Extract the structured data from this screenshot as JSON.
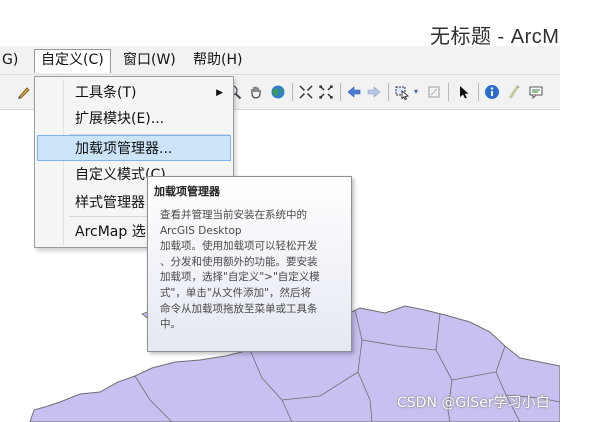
{
  "window": {
    "title": "无标题 - ArcM"
  },
  "menubar": {
    "items": [
      {
        "label": "G)"
      },
      {
        "label": "自定义(C)"
      },
      {
        "label": "窗口(W)"
      },
      {
        "label": "帮助(H)"
      }
    ]
  },
  "toolbar": {
    "icons": [
      "edit-icon",
      "zoom-in-icon",
      "pan-hand-icon",
      "full-extent-globe-icon",
      "fixed-zoom-in-icon",
      "fixed-zoom-out-icon",
      "back-arrow-icon",
      "forward-arrow-icon",
      "select-features-icon",
      "clear-selection-icon",
      "select-elements-icon",
      "identify-icon",
      "hyperlink-icon",
      "html-popup-icon"
    ]
  },
  "dropdown": {
    "items": [
      {
        "label": "工具条(T)",
        "has_submenu": true
      },
      {
        "label": "扩展模块(E)..."
      },
      {
        "label": "加载项管理器...",
        "highlighted": true
      },
      {
        "label": "自定义模式(C)"
      },
      {
        "label": "样式管理器"
      },
      {
        "label": "ArcMap 选"
      }
    ]
  },
  "tooltip": {
    "title": "加载项管理器",
    "lines": [
      "查看并管理当前安装在系统中的",
      "ArcGIS Desktop",
      "加载项。使用加载项可以轻松开发",
      "、分发和使用额外的功能。要安装",
      "加载项，选择\"自定义\">\"自定义模",
      "式\"，单击\"从文件添加\"，然后将",
      "命令从加载项拖放至菜单或工具条",
      "中。"
    ]
  },
  "watermark": {
    "text": "CSDN @GISer学习小白"
  },
  "colors": {
    "map_fill": "#c9bff0",
    "map_stroke": "#6f6f6f",
    "menu_highlight": "#cce4f7",
    "menu_highlight_border": "#7eb4ea"
  }
}
